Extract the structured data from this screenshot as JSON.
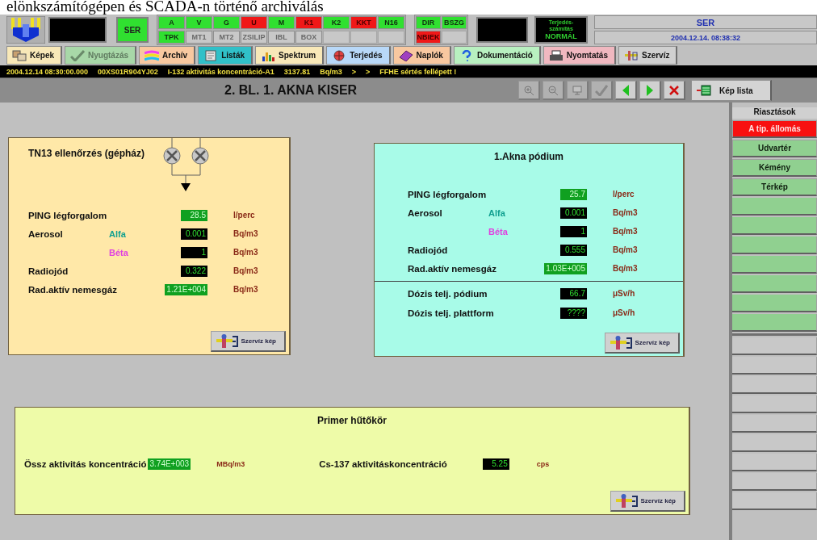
{
  "document_caption": "elönkszámítógépen és SCADA-n történő archiválás",
  "header": {
    "station": "SER",
    "indicators_top": [
      {
        "label": "A",
        "alarm": false,
        "disabled": false
      },
      {
        "label": "V",
        "alarm": false,
        "disabled": false
      },
      {
        "label": "G",
        "alarm": false,
        "disabled": false
      },
      {
        "label": "U",
        "alarm": true,
        "disabled": false
      },
      {
        "label": "M",
        "alarm": false,
        "disabled": false
      },
      {
        "label": "K1",
        "alarm": true,
        "disabled": false
      },
      {
        "label": "K2",
        "alarm": false,
        "disabled": false
      },
      {
        "label": "KKT",
        "alarm": true,
        "disabled": false
      },
      {
        "label": "N16",
        "alarm": false,
        "disabled": false
      }
    ],
    "indicators_bottom": [
      {
        "label": "TPK",
        "alarm": false,
        "disabled": false
      },
      {
        "label": "MT1",
        "alarm": false,
        "disabled": true
      },
      {
        "label": "MT2",
        "alarm": false,
        "disabled": true
      },
      {
        "label": "ZSILIP",
        "alarm": false,
        "disabled": true
      },
      {
        "label": "IBL",
        "alarm": false,
        "disabled": true
      },
      {
        "label": "BOX",
        "alarm": false,
        "disabled": true
      }
    ],
    "indicators_side_top": [
      {
        "label": "DIR",
        "alarm": false,
        "disabled": false
      },
      {
        "label": "BSZG",
        "alarm": false,
        "disabled": false
      }
    ],
    "indicators_side_bottom": [
      {
        "label": "NBIEK",
        "alarm": true,
        "disabled": false
      }
    ],
    "spread_status": {
      "line1": "Terjedés-",
      "line2": "számítás",
      "line3": "NORMÁL"
    },
    "site": "SER",
    "datetime": "2004.12.14. 08:38:32"
  },
  "toolbar": [
    {
      "label": "Képek",
      "color": "#f8e8b8",
      "disabled": false
    },
    {
      "label": "Nyugtázás",
      "color": "#a8d8a8",
      "disabled": true
    },
    {
      "label": "Archív",
      "color": "#f8c8a0",
      "disabled": false
    },
    {
      "label": "Listák",
      "color": "#30c0c8",
      "disabled": false
    },
    {
      "label": "Spektrum",
      "color": "#f8e8b8",
      "disabled": false
    },
    {
      "label": "Terjedés",
      "color": "#b8d8f8",
      "disabled": false
    },
    {
      "label": "Naplók",
      "color": "#f8c8a0",
      "disabled": false
    },
    {
      "label": "Dokumentáció",
      "color": "#b8f0c0",
      "disabled": false
    },
    {
      "label": "Nyomtatás",
      "color": "#f0b8c0",
      "disabled": false
    },
    {
      "label": "Szervíz",
      "color": "#d0d0d0",
      "disabled": false
    }
  ],
  "message_bar": [
    "2004.12.14 08:30:00.000",
    "00XS01R904YJ02",
    "I-132 aktivitás koncentráció-A1",
    "3137.81",
    "Bq/m3",
    ">",
    ">",
    "FFHE sértés fellépett !"
  ],
  "title": "2. BL. 1. AKNA KISER",
  "title_tools": [
    {
      "disabled": true
    },
    {
      "disabled": true
    },
    {
      "disabled": true
    },
    {
      "disabled": true
    },
    {
      "disabled": false
    },
    {
      "disabled": false
    },
    {
      "disabled": false
    }
  ],
  "picture_list_button": "Kép lista",
  "sidebar": {
    "header": "Riasztások",
    "items": [
      {
        "label": "A tip. állomás",
        "alarm": true
      },
      {
        "label": "Udvartér",
        "alarm": false
      },
      {
        "label": "Kémény",
        "alarm": false
      },
      {
        "label": "Térkép",
        "alarm": false
      }
    ]
  },
  "panels": [
    {
      "kind": "fans",
      "title": "TN13 ellenőrzés (gépház)",
      "service_button": "Szervíz kép",
      "rows": [
        {
          "label": "PING légforgalom",
          "value": "28.5",
          "highlight": true,
          "unit": "l/perc"
        },
        {
          "label": "Aerosol",
          "sub": {
            "text": "Alfa",
            "color": "#10a090"
          },
          "value": "0.001",
          "highlight": false,
          "unit": "Bq/m3"
        },
        {
          "sub": {
            "text": "Béta",
            "color": "#e040e0"
          },
          "value": "1",
          "highlight": false,
          "unit": "Bq/m3"
        },
        {
          "label": "Radiojód",
          "value": "0.322",
          "highlight": false,
          "unit": "Bq/m3"
        },
        {
          "label": "Rad.aktív nemesgáz",
          "value": "1.21E+004",
          "highlight": true,
          "unit": "Bq/m3"
        }
      ]
    },
    {
      "kind": "plain",
      "title": "1.Akna pódium",
      "service_button": "Szervíz kép",
      "rows": [
        {
          "label": "PING légforgalom",
          "value": "25.7",
          "highlight": true,
          "unit": "l/perc"
        },
        {
          "label": "Aerosol",
          "sub": {
            "text": "Alfa",
            "color": "#10a090"
          },
          "value": "0.001",
          "highlight": false,
          "unit": "Bq/m3"
        },
        {
          "sub": {
            "text": "Béta",
            "color": "#e040e0"
          },
          "value": "1",
          "highlight": false,
          "unit": "Bq/m3"
        },
        {
          "label": "Radiojód",
          "value": "0.555",
          "highlight": false,
          "unit": "Bq/m3"
        },
        {
          "label": "Rad.aktív nemesgáz",
          "value": "1.03E+005",
          "highlight": true,
          "unit": "Bq/m3"
        },
        {
          "label": "Dózis telj. pódium",
          "value": "66.7",
          "highlight": false,
          "unit": "μSv/h",
          "separator": true
        },
        {
          "label": "Dózis telj. plattform",
          "value": "????",
          "highlight": false,
          "unit": "μSv/h"
        }
      ]
    }
  ],
  "primary_circuit": {
    "title": "Primer hűtőkör",
    "service_button": "Szervíz kép",
    "readings": [
      {
        "label": "Össz aktivitás koncentráció",
        "value": "3.74E+003",
        "highlight": true,
        "unit": "MBq/m3"
      },
      {
        "label": "Cs-137 aktivitáskoncentráció",
        "value": "5.25",
        "highlight": false,
        "unit": "cps"
      }
    ]
  }
}
